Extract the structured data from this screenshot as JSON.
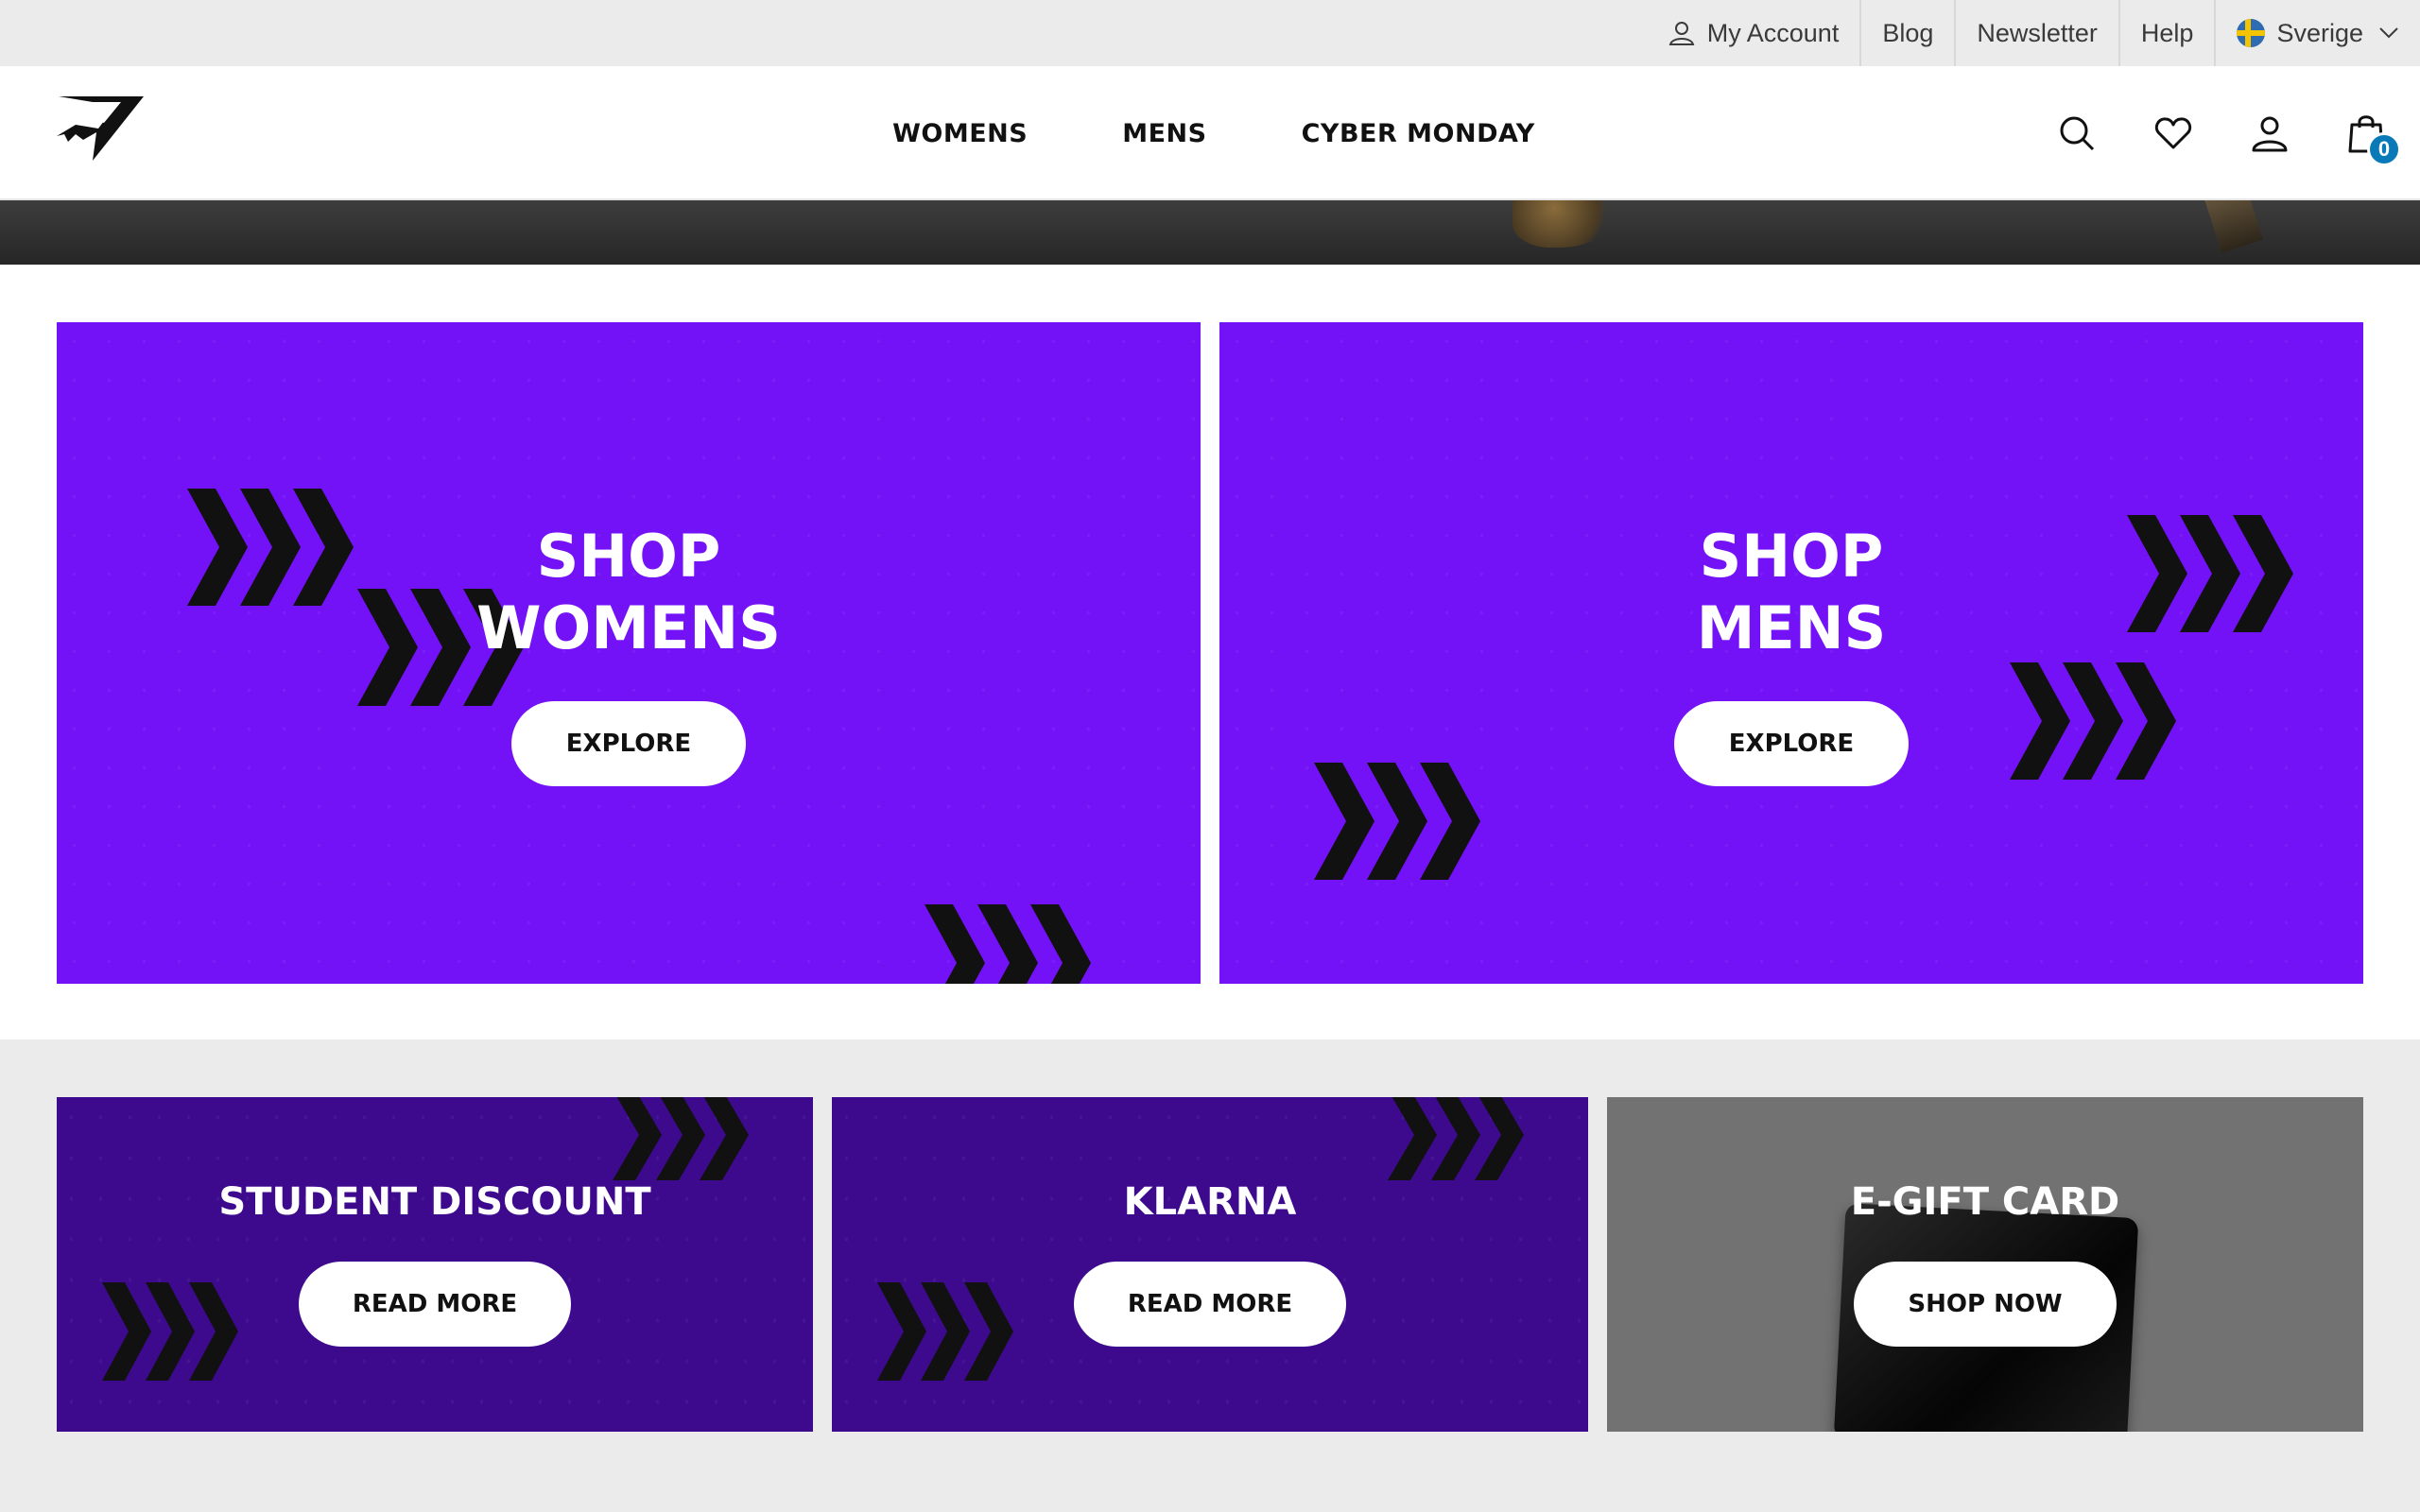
{
  "utility_bar": {
    "my_account": "My Account",
    "blog": "Blog",
    "newsletter": "Newsletter",
    "help": "Help",
    "country": "Sverige"
  },
  "header": {
    "nav": [
      "WOMENS",
      "MENS",
      "CYBER MONDAY"
    ],
    "cart_count": "0",
    "icons": [
      "search-icon",
      "heart-icon",
      "user-icon",
      "bag-icon"
    ]
  },
  "hero": {
    "womens": {
      "line1": "SHOP",
      "line2": "WOMENS",
      "button": "EXPLORE"
    },
    "mens": {
      "line1": "SHOP",
      "line2": "MENS",
      "button": "EXPLORE"
    }
  },
  "cards": [
    {
      "title": "STUDENT DISCOUNT",
      "button": "READ MORE"
    },
    {
      "title": "KLARNA",
      "button": "READ MORE"
    },
    {
      "title": "E-GIFT CARD",
      "button": "SHOP NOW"
    }
  ],
  "colors": {
    "hero_purple": "#7412f7",
    "card_purple": "#3d0a8e",
    "card_grey": "#727272",
    "cart_badge": "#0a79b8",
    "band_grey": "#ebebeb"
  }
}
